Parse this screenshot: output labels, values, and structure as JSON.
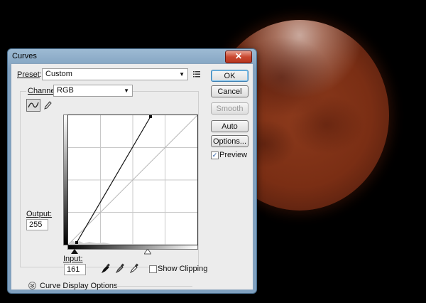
{
  "window": {
    "title": "Curves",
    "close_glyph": "✕"
  },
  "preset": {
    "label": "Preset",
    "value": "Custom"
  },
  "channel": {
    "label": "Channel",
    "value": "RGB"
  },
  "buttons": {
    "ok": "OK",
    "cancel": "Cancel",
    "smooth": "Smooth",
    "auto": "Auto",
    "options": "Options..."
  },
  "preview": {
    "label": "Preview",
    "checked": true
  },
  "output": {
    "label": "Output:",
    "value": "255"
  },
  "input": {
    "label": "Input:",
    "value": "161"
  },
  "show_clipping": {
    "label": "Show Clipping",
    "checked": false
  },
  "curve_display_options": {
    "label": "Curve Display Options"
  },
  "icons": {
    "preset_menu": "list-menu-icon",
    "curve_tool": "curve-point-tool-icon",
    "pencil_tool": "pencil-icon",
    "black_eyedropper": "eyedropper-black-icon",
    "gray_eyedropper": "eyedropper-gray-icon",
    "white_eyedropper": "eyedropper-white-icon",
    "expand": "expand-chevron-icon"
  }
}
